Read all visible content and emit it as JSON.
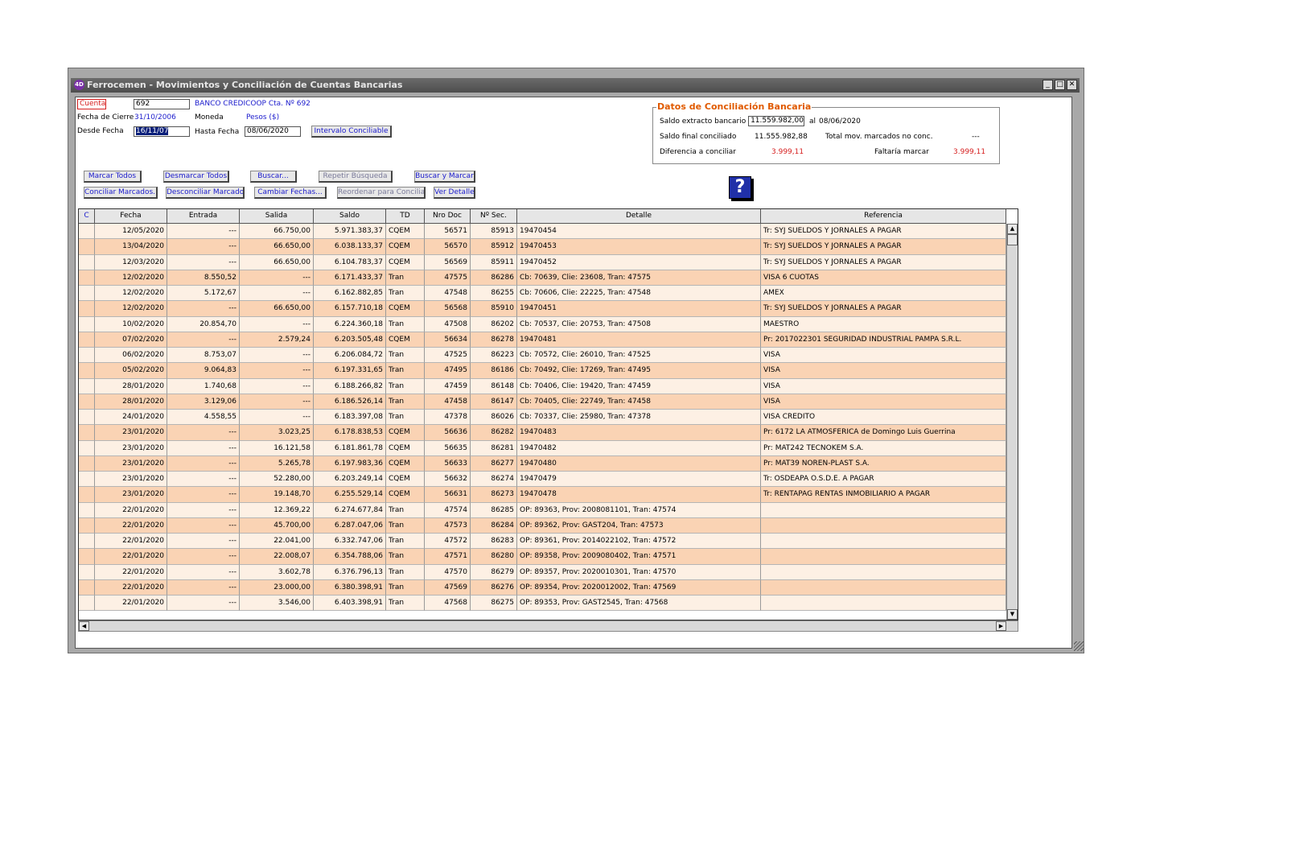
{
  "window": {
    "logo": "4D",
    "title": "Ferrocemen - Movimientos y Conciliación de Cuentas Bancarias",
    "minimize": "_",
    "maximize": "□",
    "close": "✕"
  },
  "form": {
    "cuenta_label": "Cuenta",
    "cuenta_value": "692",
    "banco": "BANCO CREDICOOP Cta. Nº 692",
    "fecha_cierre_label": "Fecha de Cierre",
    "fecha_cierre_value": "31/10/2006",
    "moneda_label": "Moneda",
    "moneda_value": "Pesos ($)",
    "desde_label": "Desde Fecha",
    "desde_value": "16/11/07",
    "hasta_label": "Hasta Fecha",
    "hasta_value": "08/06/2020",
    "intervalo_button": "Intervalo Conciliable"
  },
  "conciliacion": {
    "title": "Datos de Conciliación Bancaria",
    "saldo_extracto_label": "Saldo extracto bancario",
    "saldo_extracto_value": "11.559.982,00",
    "al_label": "al",
    "al_date": "08/06/2020",
    "saldo_final_label": "Saldo final conciliado",
    "saldo_final_value": "11.555.982,88",
    "total_mov_label": "Total mov. marcados no conc.",
    "total_mov_value": "---",
    "diferencia_label": "Diferencia a conciliar",
    "diferencia_value": "3.999,11",
    "faltaria_label": "Faltaría marcar",
    "faltaria_value": "3.999,11"
  },
  "toolbar": {
    "marcar_todos": "Marcar Todos",
    "desmarcar_todos": "Desmarcar Todos",
    "buscar": "Buscar...",
    "repetir_busqueda": "Repetir Búsqueda",
    "buscar_y_marcar": "Buscar y Marcar",
    "conciliar_marcados": "Conciliar Marcados...",
    "desconciliar_marcados": "Desconciliar Marcados",
    "cambiar_fechas": "Cambiar Fechas...",
    "reordenar": "Reordenar para Conciliar",
    "ver_detalle": "Ver Detalle",
    "help_glyph": "?"
  },
  "table": {
    "headers": [
      "C",
      "Fecha",
      "Entrada",
      "Salida",
      "Saldo",
      "TD",
      "Nro Doc",
      "Nº Sec.",
      "Detalle",
      "Referencia"
    ],
    "rows": [
      [
        "",
        "12/05/2020",
        "---",
        "66.750,00",
        "5.971.383,37",
        "CQEM",
        "56571",
        "85913",
        "19470454",
        "Tr: SYJ SUELDOS Y JORNALES A PAGAR"
      ],
      [
        "",
        "13/04/2020",
        "---",
        "66.650,00",
        "6.038.133,37",
        "CQEM",
        "56570",
        "85912",
        "19470453",
        "Tr: SYJ SUELDOS Y JORNALES A PAGAR"
      ],
      [
        "",
        "12/03/2020",
        "---",
        "66.650,00",
        "6.104.783,37",
        "CQEM",
        "56569",
        "85911",
        "19470452",
        "Tr: SYJ SUELDOS Y JORNALES A PAGAR"
      ],
      [
        "",
        "12/02/2020",
        "8.550,52",
        "---",
        "6.171.433,37",
        "Tran",
        "47575",
        "86286",
        "Cb: 70639,  Clie: 23608,  Tran: 47575",
        "VISA 6 CUOTAS"
      ],
      [
        "",
        "12/02/2020",
        "5.172,67",
        "---",
        "6.162.882,85",
        "Tran",
        "47548",
        "86255",
        "Cb: 70606,  Clie: 22225,  Tran: 47548",
        "AMEX"
      ],
      [
        "",
        "12/02/2020",
        "---",
        "66.650,00",
        "6.157.710,18",
        "CQEM",
        "56568",
        "85910",
        "19470451",
        "Tr: SYJ SUELDOS Y JORNALES A PAGAR"
      ],
      [
        "",
        "10/02/2020",
        "20.854,70",
        "---",
        "6.224.360,18",
        "Tran",
        "47508",
        "86202",
        "Cb: 70537,  Clie: 20753,  Tran: 47508",
        "MAESTRO"
      ],
      [
        "",
        "07/02/2020",
        "---",
        "2.579,24",
        "6.203.505,48",
        "CQEM",
        "56634",
        "86278",
        "19470481",
        "Pr: 2017022301 SEGURIDAD INDUSTRIAL PAMPA S.R.L."
      ],
      [
        "",
        "06/02/2020",
        "8.753,07",
        "---",
        "6.206.084,72",
        "Tran",
        "47525",
        "86223",
        "Cb: 70572,  Clie: 26010,  Tran: 47525",
        "VISA"
      ],
      [
        "",
        "05/02/2020",
        "9.064,83",
        "---",
        "6.197.331,65",
        "Tran",
        "47495",
        "86186",
        "Cb: 70492,  Clie: 17269,  Tran: 47495",
        "VISA"
      ],
      [
        "",
        "28/01/2020",
        "1.740,68",
        "---",
        "6.188.266,82",
        "Tran",
        "47459",
        "86148",
        "Cb: 70406,  Clie: 19420,  Tran: 47459",
        "VISA"
      ],
      [
        "",
        "28/01/2020",
        "3.129,06",
        "---",
        "6.186.526,14",
        "Tran",
        "47458",
        "86147",
        "Cb: 70405,  Clie: 22749,  Tran: 47458",
        "VISA"
      ],
      [
        "",
        "24/01/2020",
        "4.558,55",
        "---",
        "6.183.397,08",
        "Tran",
        "47378",
        "86026",
        "Cb: 70337,  Clie: 25980,  Tran: 47378",
        "VISA CREDITO"
      ],
      [
        "",
        "23/01/2020",
        "---",
        "3.023,25",
        "6.178.838,53",
        "CQEM",
        "56636",
        "86282",
        "19470483",
        "Pr: 6172 LA ATMOSFERICA de Domingo Luis Guerrina"
      ],
      [
        "",
        "23/01/2020",
        "---",
        "16.121,58",
        "6.181.861,78",
        "CQEM",
        "56635",
        "86281",
        "19470482",
        "Pr: MAT242 TECNOKEM S.A."
      ],
      [
        "",
        "23/01/2020",
        "---",
        "5.265,78",
        "6.197.983,36",
        "CQEM",
        "56633",
        "86277",
        "19470480",
        "Pr: MAT39 NOREN-PLAST S.A."
      ],
      [
        "",
        "23/01/2020",
        "---",
        "52.280,00",
        "6.203.249,14",
        "CQEM",
        "56632",
        "86274",
        "19470479",
        "Tr: OSDEAPA O.S.D.E. A  PAGAR"
      ],
      [
        "",
        "23/01/2020",
        "---",
        "19.148,70",
        "6.255.529,14",
        "CQEM",
        "56631",
        "86273",
        "19470478",
        "Tr: RENTAPAG RENTAS INMOBILIARIO A PAGAR"
      ],
      [
        "",
        "22/01/2020",
        "---",
        "12.369,22",
        "6.274.677,84",
        "Tran",
        "47574",
        "86285",
        "OP: 89363,  Prov: 2008081101,  Tran: 47574",
        ""
      ],
      [
        "",
        "22/01/2020",
        "---",
        "45.700,00",
        "6.287.047,06",
        "Tran",
        "47573",
        "86284",
        "OP: 89362,  Prov: GAST204,  Tran: 47573",
        ""
      ],
      [
        "",
        "22/01/2020",
        "---",
        "22.041,00",
        "6.332.747,06",
        "Tran",
        "47572",
        "86283",
        "OP: 89361,  Prov: 2014022102,  Tran: 47572",
        ""
      ],
      [
        "",
        "22/01/2020",
        "---",
        "22.008,07",
        "6.354.788,06",
        "Tran",
        "47571",
        "86280",
        "OP: 89358,  Prov: 2009080402,  Tran: 47571",
        ""
      ],
      [
        "",
        "22/01/2020",
        "---",
        "3.602,78",
        "6.376.796,13",
        "Tran",
        "47570",
        "86279",
        "OP: 89357,  Prov: 2020010301,  Tran: 47570",
        ""
      ],
      [
        "",
        "22/01/2020",
        "---",
        "23.000,00",
        "6.380.398,91",
        "Tran",
        "47569",
        "86276",
        "OP: 89354,  Prov: 2020012002,  Tran: 47569",
        ""
      ],
      [
        "",
        "22/01/2020",
        "---",
        "3.546,00",
        "6.403.398,91",
        "Tran",
        "47568",
        "86275",
        "OP: 89353,  Prov: GAST2545,  Tran: 47568",
        ""
      ]
    ]
  },
  "scroll": {
    "up": "▲",
    "down": "▼",
    "left": "◀",
    "right": "▶"
  },
  "colors": {
    "row_odd": "#fdf0e4",
    "row_even": "#fad3b4",
    "accent_orange": "#e05a00",
    "link_blue": "#1a1acc",
    "alert_red": "#d62020"
  }
}
